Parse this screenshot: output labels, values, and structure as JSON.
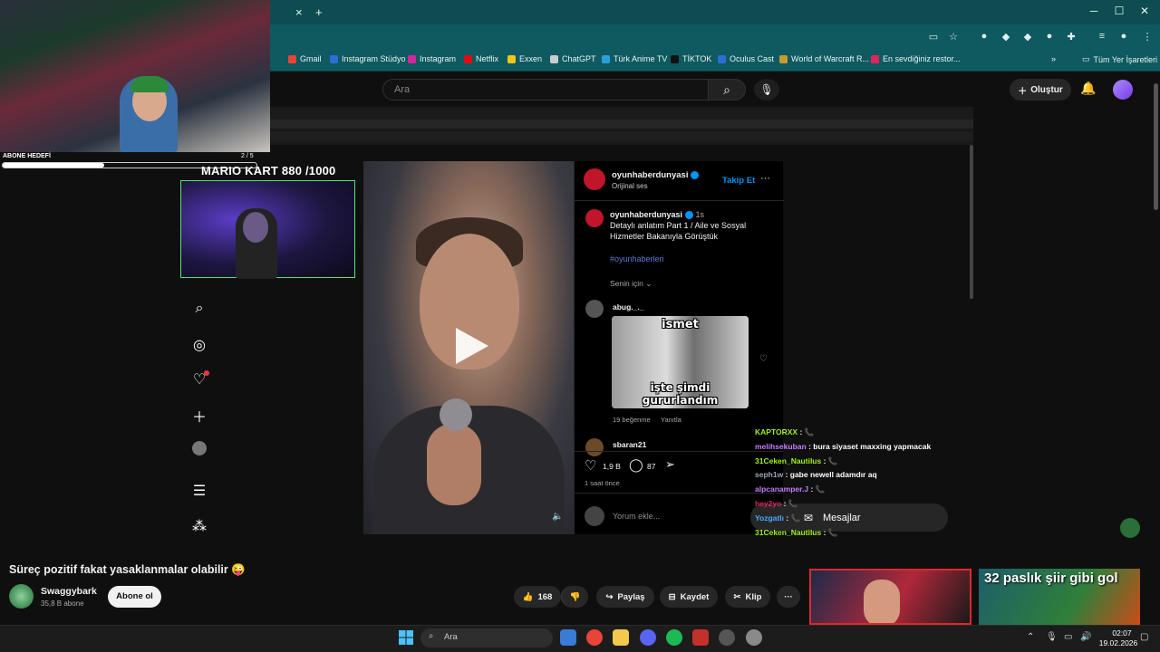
{
  "browser": {
    "tab_add": "+",
    "tab_close": "×",
    "bookmarks": [
      {
        "label": "Gmail",
        "color": "#ea4335"
      },
      {
        "label": "Instagram Stüdyo",
        "color": "#2b6fd6"
      },
      {
        "label": "Instagram",
        "color": "#d6249f"
      },
      {
        "label": "Netflix",
        "color": "#e50914"
      },
      {
        "label": "Exxen",
        "color": "#f5c518"
      },
      {
        "label": "ChatGPT",
        "color": "#cccccc"
      },
      {
        "label": "Türk Anime TV",
        "color": "#2aa0d8"
      },
      {
        "label": "TİKTOK",
        "color": "#111111"
      },
      {
        "label": "Oculus Cast",
        "color": "#2b6fd6"
      },
      {
        "label": "World of Warcraft R...",
        "color": "#c79c2b"
      },
      {
        "label": "En sevdiğiniz restor...",
        "color": "#e0245e"
      }
    ],
    "bookmarks_more": "»",
    "all_bookmarks": "Tüm Yer İşaretleri",
    "window": {
      "minimize": "─",
      "maximize": "☐",
      "close": "✕"
    }
  },
  "youtube_header": {
    "search_placeholder": "Ara",
    "create_label": "Oluştur"
  },
  "stream_overlay": {
    "sub_goal_label": "ABONE HEDEFİ",
    "sub_goal_count": "2 / 5",
    "sub_goal_progress": 0.4,
    "mario_kart": "MARIO KART   880 /1000"
  },
  "instagram": {
    "author": "oyunhaberdunyasi",
    "audio": "Orijinal ses",
    "follow": "Takip Et",
    "more": "···",
    "caption_author": "oyunhaberdunyasi",
    "caption_time": "1s",
    "caption_line1": "Detaylı anlatım Part 1 / Aile ve Sosyal",
    "caption_line2": "Hizmetler Bakanıyla Görüştük",
    "hashtag": "#oyunhaberleri",
    "sort": "Senin için",
    "comment1_user": "abug._._",
    "meme_top": "ismet",
    "meme_bottom": "işte şimdi gururlandım",
    "comment1_likes": "19 beğenme",
    "comment1_reply": "Yanıtla",
    "comment2_user": "sbaran21",
    "likes": "1,9 B",
    "comments": "87",
    "posted": "1 saat önce",
    "add_comment": "Yorum ekle...",
    "messages": "Mesajlar"
  },
  "chat": [
    {
      "user": "KAPTORXX",
      "user_color": "#9ef01a",
      "msg": ": 📞"
    },
    {
      "user": "melihsekuban",
      "user_color": "#c77dff",
      "msg": ": bura siyaset maxxing yapmacak"
    },
    {
      "user": "31Ceken_Nautilus",
      "user_color": "#9ef01a",
      "msg": ": 📞"
    },
    {
      "user": "seph1w",
      "user_color": "#9aa7b8",
      "msg": ": gabe newell adamdır aq"
    },
    {
      "user": "alpcanamper.J",
      "user_color": "#c77dff",
      "msg": ": 📞"
    },
    {
      "user": "hey2yo",
      "user_color": "#e0245e",
      "msg": ": 📞"
    },
    {
      "user": "Yozgatlı",
      "user_color": "#4ea8ff",
      "msg": ": 📞"
    },
    {
      "user": "31Ceken_Nautilus",
      "user_color": "#9ef01a",
      "msg": ": 📞"
    }
  ],
  "video": {
    "title": "Süreç pozitif fakat yasaklanmalar olabilir 😜",
    "channel": "Swaggybark",
    "subscribers": "35,8 B abone",
    "subscribe": "Abone ol",
    "like_count": "168",
    "share": "Paylaş",
    "save": "Kaydet",
    "clip": "Klip",
    "more": "···"
  },
  "recommended": {
    "thumb2_title": "32 paslık şiir gibi gol"
  },
  "taskbar": {
    "search": "Ara",
    "time": "02:07",
    "date": "19.02.2026"
  }
}
